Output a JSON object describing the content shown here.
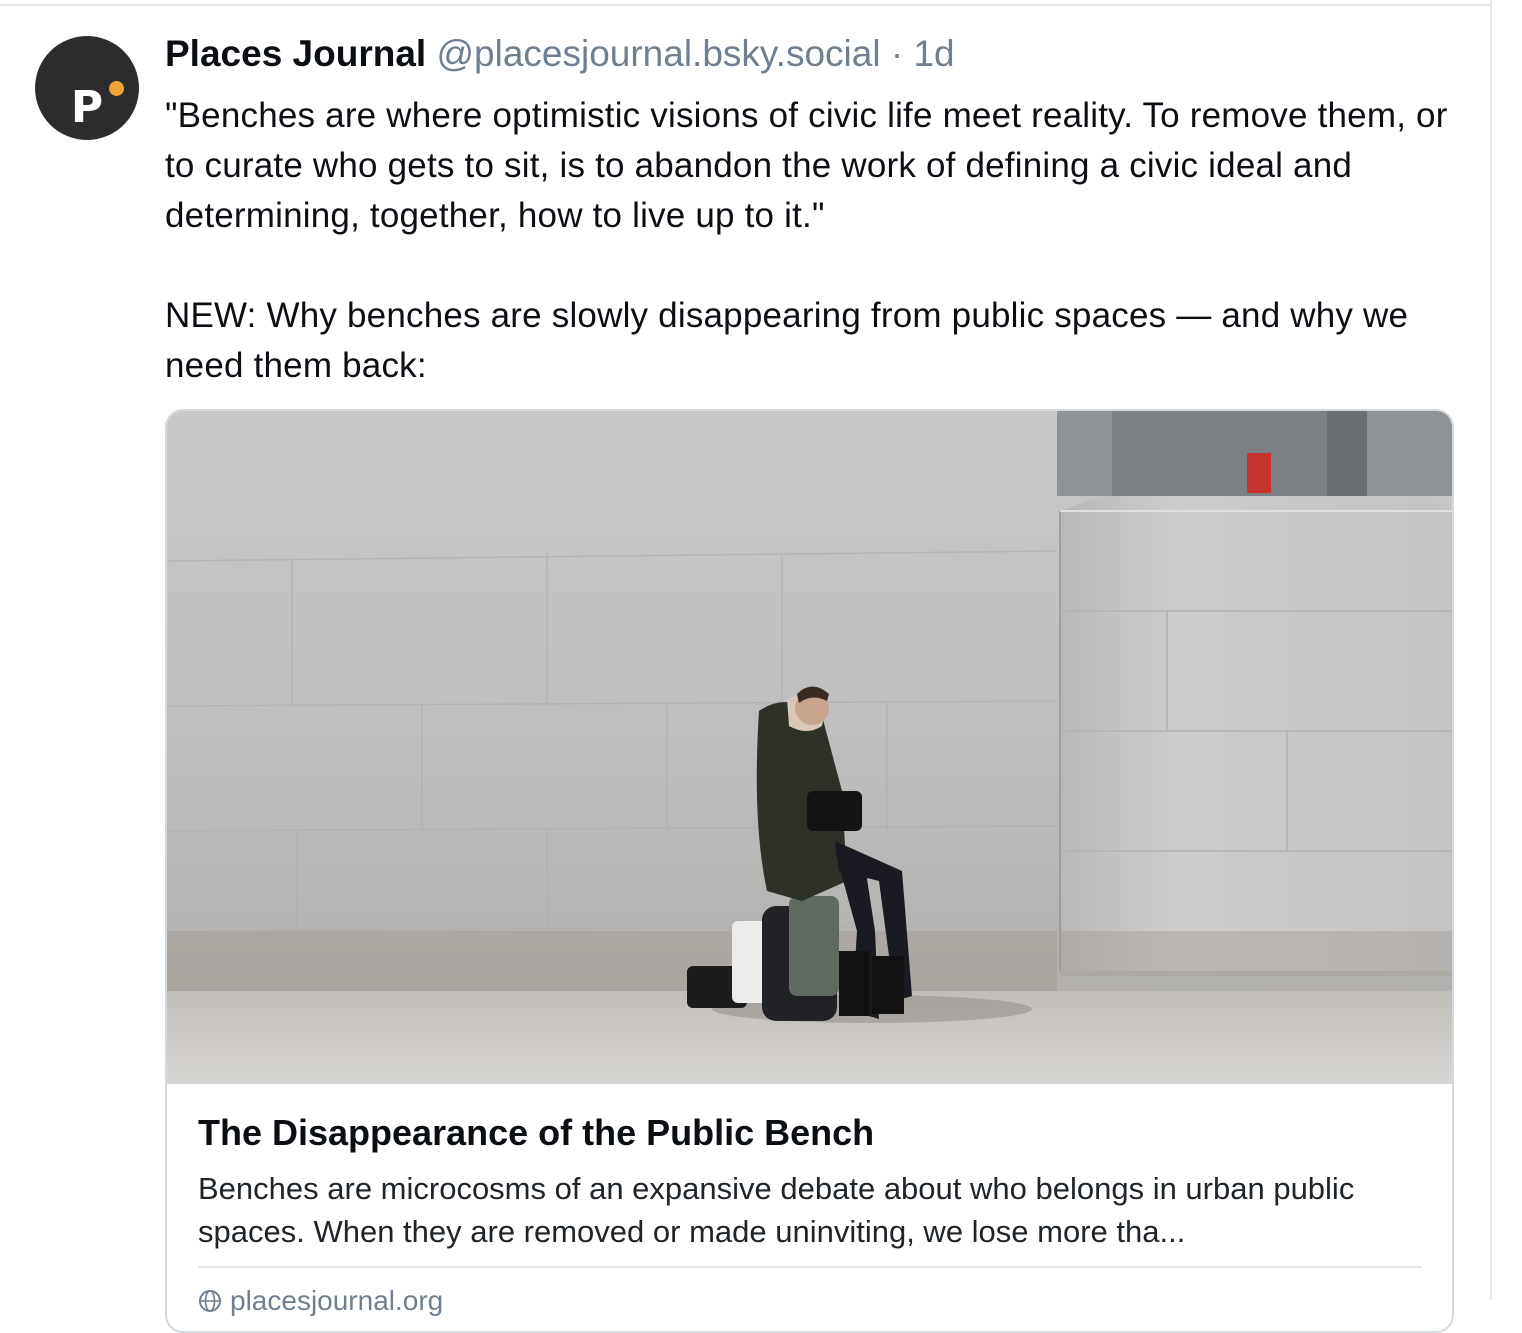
{
  "post": {
    "author": {
      "display_name": "Places Journal",
      "handle": "@placesjournal.bsky.social",
      "avatar_letter": "P",
      "avatar_bg": "#2c2c2c",
      "avatar_dot_color": "#f2a33a"
    },
    "separator": "·",
    "time": "1d",
    "text_paragraphs": [
      "\"Benches are where optimistic visions of civic life meet reality. To remove them, or to curate who gets to sit, is to abandon the work of defining a civic ideal and determining, together, how to live up to it.\"",
      "NEW: Why benches are slowly disappearing from public spaces — and why we need them back:"
    ],
    "link_card": {
      "image_icon": "photo-woman-sitting-on-suitcase-against-marble-wall",
      "title": "The Disappearance of the Public Bench",
      "description": "Benches are microcosms of an expansive debate about who belongs in urban public spaces. When they are removed or made uninviting, we lose more tha...",
      "domain": "placesjournal.org",
      "domain_icon": "globe-icon"
    }
  }
}
